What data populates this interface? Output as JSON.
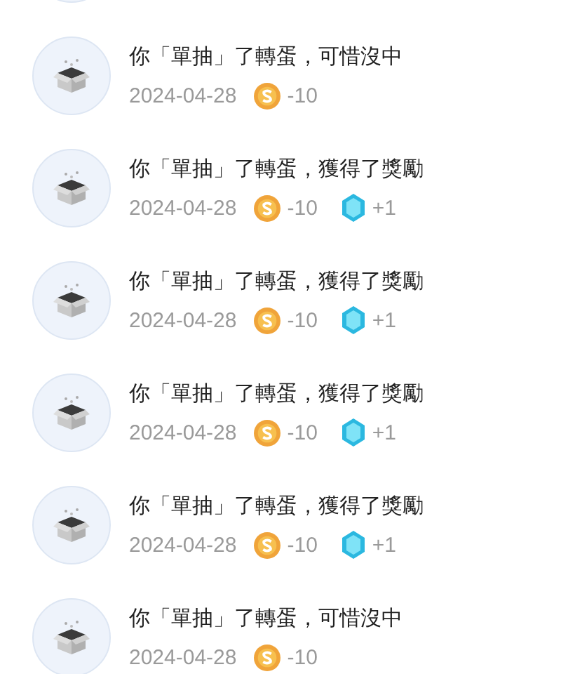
{
  "records": [
    {
      "title": "你「單抽」了轉蛋，可惜沒中",
      "date": "2024-04-28",
      "coin": "-10"
    },
    {
      "title": "你「單抽」了轉蛋，獲得了獎勵",
      "date": "2024-04-28",
      "coin": "-10",
      "gem": "+1"
    },
    {
      "title": "你「單抽」了轉蛋，獲得了獎勵",
      "date": "2024-04-28",
      "coin": "-10",
      "gem": "+1"
    },
    {
      "title": "你「單抽」了轉蛋，獲得了獎勵",
      "date": "2024-04-28",
      "coin": "-10",
      "gem": "+1"
    },
    {
      "title": "你「單抽」了轉蛋，獲得了獎勵",
      "date": "2024-04-28",
      "coin": "-10",
      "gem": "+1"
    },
    {
      "title": "你「單抽」了轉蛋，可惜沒中",
      "date": "2024-04-28",
      "coin": "-10"
    }
  ]
}
